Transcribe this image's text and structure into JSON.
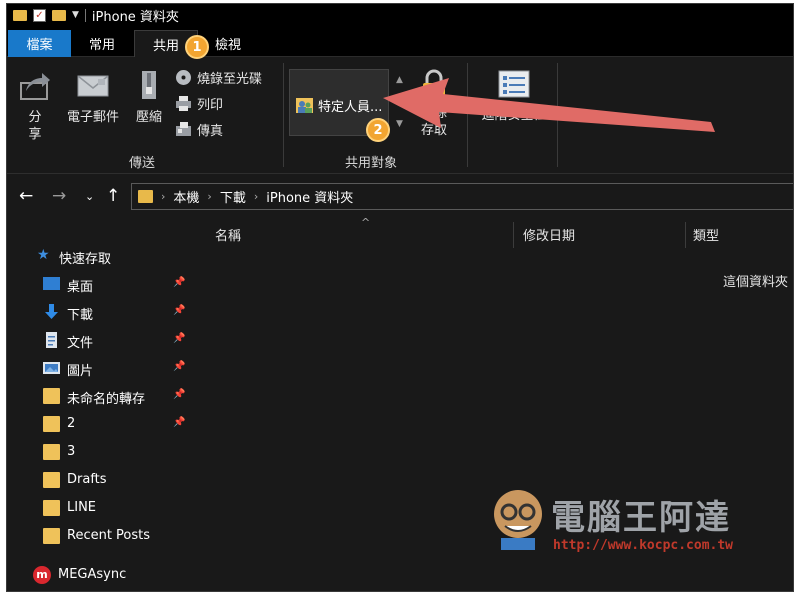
{
  "window": {
    "title": "iPhone 資料夾"
  },
  "tabs": {
    "file": "檔案",
    "home": "常用",
    "share": "共用",
    "view": "檢視"
  },
  "ribbon": {
    "share_label_1": "分",
    "share_label_2": "享",
    "email": "電子郵件",
    "zip": "壓縮",
    "burn": "燒錄至光碟",
    "print": "列印",
    "fax": "傳真",
    "send_group": "傳送",
    "specific_people": "特定人員...",
    "remove_access_1": "移除",
    "remove_access_2": "存取",
    "share_with_group": "共用對象",
    "advanced_security": "進階安全性"
  },
  "address": {
    "crumbs": [
      "本機",
      "下載",
      "iPhone 資料夾"
    ]
  },
  "nav": {
    "quick_access": "快速存取",
    "items": [
      {
        "label": "桌面",
        "icon": "desktop-icon"
      },
      {
        "label": "下載",
        "icon": "download-icon"
      },
      {
        "label": "文件",
        "icon": "document-icon"
      },
      {
        "label": "圖片",
        "icon": "pictures-icon"
      },
      {
        "label": "未命名的轉存",
        "icon": "folder-icon"
      },
      {
        "label": "2",
        "icon": "folder-icon"
      },
      {
        "label": "3",
        "icon": "folder-icon"
      },
      {
        "label": "Drafts",
        "icon": "folder-icon"
      },
      {
        "label": "LINE",
        "icon": "folder-icon"
      },
      {
        "label": "Recent Posts",
        "icon": "folder-icon"
      }
    ],
    "mega": "MEGAsync"
  },
  "columns": {
    "name": "名稱",
    "date": "修改日期",
    "type": "類型"
  },
  "content": {
    "empty": "這個資料夾"
  },
  "annotations": {
    "step1": "1",
    "step2": "2"
  },
  "watermark": {
    "title": "電腦王阿達",
    "url": "http://www.kocpc.com.tw"
  },
  "colors": {
    "accent": "#1979ca",
    "badge": "#f2a531",
    "arrow": "#e06b66",
    "folder": "#efc25a"
  }
}
